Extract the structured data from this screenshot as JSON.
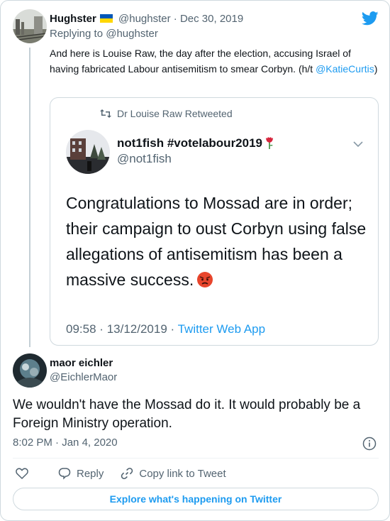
{
  "parent_tweet": {
    "author_name": "Hughster",
    "handle": "@hughster",
    "separator": "·",
    "date": "Dec 30, 2019",
    "replying_prefix": "Replying to",
    "replying_handle": "@hughster",
    "text": "And here is Louise Raw, the day after the election, accusing Israel of having fabricated Labour antisemitism to smear Corbyn. (h/t ",
    "text_link": "@KatieCurtis",
    "text_end": ")",
    "flag_icon": "ukraine-flag-icon"
  },
  "quoted_tweet": {
    "retweeted_by": "Dr Louise Raw Retweeted",
    "author_name": "not1fish #votelabour2019",
    "handle": "@not1fish",
    "text": "Congratulations to Mossad are in order; their campaign to oust Corbyn using false allegations of antisemitism has been a massive success.",
    "time": "09:58",
    "date": "13/12/2019",
    "separator": "·",
    "source": "Twitter Web App",
    "emoji_name_icon": "rose-emoji-icon",
    "emoji_end_icon": "angry-face-emoji-icon"
  },
  "reply_tweet": {
    "author_name": "maor eichler",
    "handle": "@EichlerMaor",
    "text": "We wouldn't have the Mossad do it. It would probably be a Foreign Ministry operation.",
    "time": "8:02 PM",
    "separator": "·",
    "date": "Jan 4, 2020"
  },
  "actions": {
    "like_icon": "heart-icon",
    "reply_label": "Reply",
    "copy_link_label": "Copy link to Tweet"
  },
  "footer": {
    "explore_label": "Explore what's happening on Twitter"
  },
  "colors": {
    "accent": "#1d9bf0",
    "muted": "#536471",
    "text": "#0f1419",
    "border": "#cfd9de"
  }
}
